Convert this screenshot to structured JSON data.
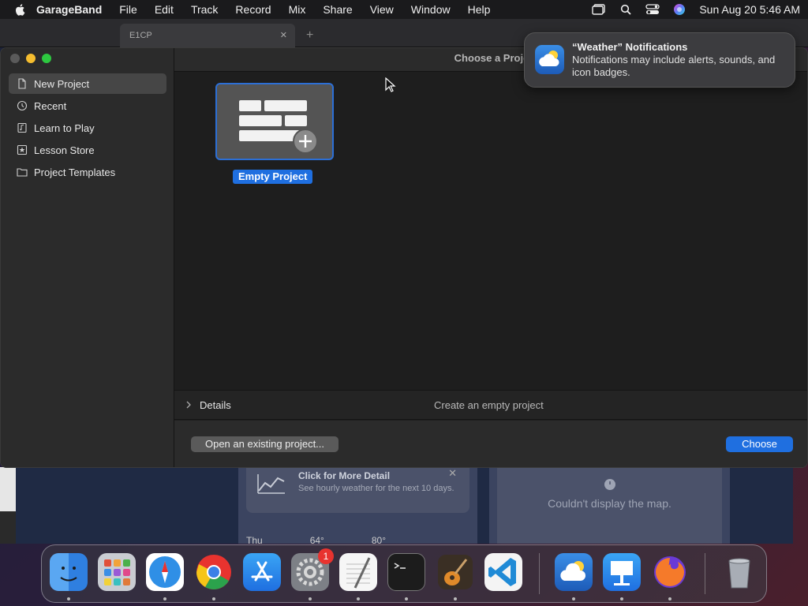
{
  "menubar": {
    "app_name": "GarageBand",
    "items": [
      "File",
      "Edit",
      "Track",
      "Record",
      "Mix",
      "Share",
      "View",
      "Window",
      "Help"
    ],
    "datetime": "Sun Aug 20  5:46 AM"
  },
  "background_window": {
    "tab_title": "E1CP"
  },
  "weather_bg": {
    "card_title": "Click for More Detail",
    "card_sub": "See hourly weather for the next 10 days.",
    "row_day": "Thu",
    "row_low": "64°",
    "row_high": "80°",
    "map_message": "Couldn't display the map."
  },
  "window": {
    "title": "Choose a Proje",
    "sidebar": {
      "items": [
        {
          "label": "New Project",
          "icon": "document-icon",
          "selected": true
        },
        {
          "label": "Recent",
          "icon": "clock-icon",
          "selected": false
        },
        {
          "label": "Learn to Play",
          "icon": "music-book-icon",
          "selected": false
        },
        {
          "label": "Lesson Store",
          "icon": "star-box-icon",
          "selected": false
        },
        {
          "label": "Project Templates",
          "icon": "folder-icon",
          "selected": false
        }
      ]
    },
    "template": {
      "label": "Empty Project"
    },
    "details": {
      "label": "Details",
      "description": "Create an empty project"
    },
    "footer": {
      "open_label": "Open an existing project...",
      "choose_label": "Choose"
    }
  },
  "notification": {
    "title": "“Weather” Notifications",
    "body": "Notifications may include alerts, sounds, and icon badges."
  },
  "dock": {
    "apps": [
      {
        "name": "finder-icon",
        "color": "#3a8ef0"
      },
      {
        "name": "launchpad-icon",
        "color": "#9aa0a8"
      },
      {
        "name": "safari-icon",
        "color": "#2f8fe6"
      },
      {
        "name": "chrome-icon",
        "color": "#e8e8e8"
      },
      {
        "name": "app-store-icon",
        "color": "#1f8ef0"
      },
      {
        "name": "system-settings-icon",
        "color": "#8a8d92"
      },
      {
        "name": "textedit-icon",
        "color": "#f4f4f4"
      },
      {
        "name": "terminal-icon",
        "color": "#1c1c1c"
      },
      {
        "name": "garageband-icon",
        "color": "#5a4630"
      },
      {
        "name": "vscode-icon",
        "color": "#f2f2f2"
      },
      {
        "name": "weather-icon",
        "color": "#2f86e6"
      },
      {
        "name": "keynote-icon",
        "color": "#1c7fe6"
      },
      {
        "name": "firefox-icon",
        "color": "#6a3ad6"
      },
      {
        "name": "trash-icon",
        "color": "#9aa0a8"
      }
    ],
    "settings_badge": "1"
  },
  "colors": {
    "accent": "#1f6fe0",
    "window_bg": "#1e1e1e",
    "sidebar_bg": "#2b2b2b"
  }
}
